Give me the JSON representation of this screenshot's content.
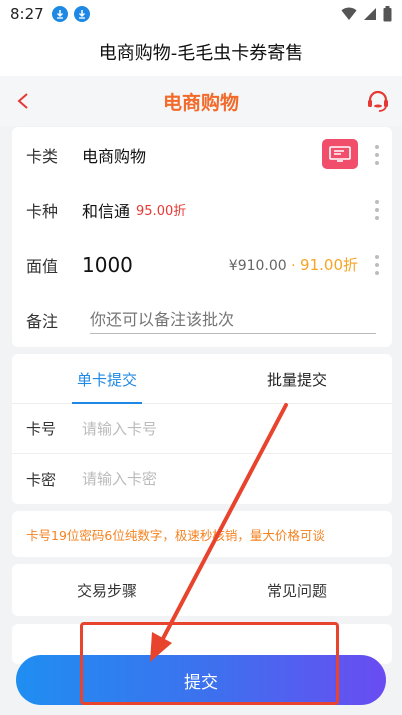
{
  "status_bar": {
    "time": "8:27",
    "icons": [
      "download-icon",
      "download-icon",
      "wifi-icon",
      "signal-icon",
      "battery-icon"
    ]
  },
  "app_title": "电商购物-毛毛虫卡券寄售",
  "nav": {
    "title": "电商购物",
    "accent": "#f26b2b"
  },
  "form": {
    "card_type": {
      "label": "卡类",
      "value": "电商购物"
    },
    "card_kind": {
      "label": "卡种",
      "value": "和信通",
      "discount": "95.00折"
    },
    "face_value": {
      "label": "面值",
      "value": "1000",
      "price": "¥910.00",
      "separator": "·",
      "rate": "91.00折"
    },
    "remark": {
      "label": "备注",
      "placeholder": "你还可以备注该批次"
    }
  },
  "tabs": {
    "single": "单卡提交",
    "batch": "批量提交"
  },
  "inputs": {
    "card_no": {
      "label": "卡号",
      "placeholder": "请输入卡号"
    },
    "card_pwd": {
      "label": "卡密",
      "placeholder": "请输入卡密"
    }
  },
  "tip": "卡号19位密码6位纯数字，极速秒核销，量大价格可谈",
  "help": {
    "steps": "交易步骤",
    "faq": "常见问题"
  },
  "submit": {
    "label": "提交",
    "gradient_start": "#1f8ef1",
    "gradient_end": "#6a4cf2"
  },
  "annotation": {
    "color": "#e8432d"
  }
}
